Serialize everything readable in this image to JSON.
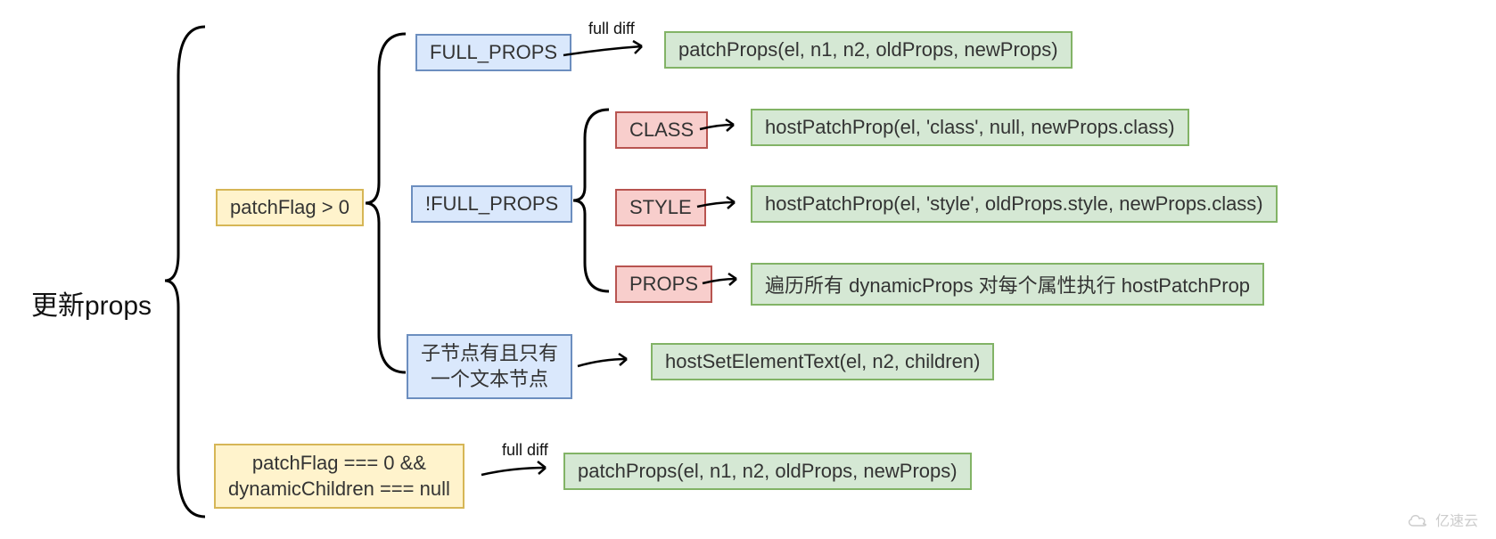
{
  "root": {
    "title": "更新props"
  },
  "branch1": {
    "label": "patchFlag > 0",
    "child1": {
      "label": "FULL_PROPS",
      "arrowNote": "full diff",
      "result": "patchProps(el, n1, n2, oldProps, newProps)"
    },
    "child2": {
      "label": "!FULL_PROPS",
      "sub1": {
        "label": "CLASS",
        "result": "hostPatchProp(el, 'class', null, newProps.class)"
      },
      "sub2": {
        "label": "STYLE",
        "result": "hostPatchProp(el, 'style', oldProps.style, newProps.class)"
      },
      "sub3": {
        "label": "PROPS",
        "result": "遍历所有 dynamicProps 对每个属性执行 hostPatchProp"
      }
    },
    "child3": {
      "line1": "子节点有且只有",
      "line2": "一个文本节点",
      "result": "hostSetElementText(el, n2, children)"
    }
  },
  "branch2": {
    "line1": "patchFlag === 0  &&",
    "line2": "dynamicChildren === null",
    "arrowNote": "full diff",
    "result": "patchProps(el, n1, n2, oldProps, newProps)"
  },
  "watermark": "亿速云"
}
